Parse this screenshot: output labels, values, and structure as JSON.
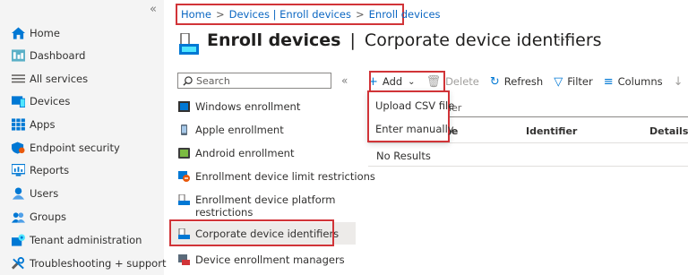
{
  "leftnav": {
    "collapse": "«",
    "items": [
      {
        "label": "Home",
        "icon": "home-icon"
      },
      {
        "label": "Dashboard",
        "icon": "dashboard-icon"
      },
      {
        "label": "All services",
        "icon": "list-icon"
      },
      {
        "label": "Devices",
        "icon": "devices-icon"
      },
      {
        "label": "Apps",
        "icon": "apps-icon"
      },
      {
        "label": "Endpoint security",
        "icon": "shield-icon"
      },
      {
        "label": "Reports",
        "icon": "reports-icon"
      },
      {
        "label": "Users",
        "icon": "user-icon"
      },
      {
        "label": "Groups",
        "icon": "groups-icon"
      },
      {
        "label": "Tenant administration",
        "icon": "tenant-admin-icon"
      },
      {
        "label": "Troubleshooting + support",
        "icon": "wrench-icon"
      }
    ]
  },
  "breadcrumb": {
    "items": [
      "Home",
      "Devices | Enroll devices",
      "Enroll devices"
    ],
    "separator": ">"
  },
  "header": {
    "title": "Enroll devices",
    "separator": "|",
    "subtitle": "Corporate device identifiers",
    "more": "···"
  },
  "subnav": {
    "search_placeholder": "Search",
    "collapse": "«",
    "items": [
      {
        "label": "Windows enrollment"
      },
      {
        "label": "Apple enrollment"
      },
      {
        "label": "Android enrollment"
      },
      {
        "label": "Enrollment device limit restrictions"
      },
      {
        "label_line1": "Enrollment device platform",
        "label_line2": "restrictions"
      },
      {
        "label": "Corporate device identifiers",
        "selected": true
      },
      {
        "label": "Device enrollment managers"
      }
    ]
  },
  "toolbar": {
    "add": "Add",
    "delete": "Delete",
    "refresh": "Refresh",
    "filter": "Filter",
    "columns": "Columns"
  },
  "add_menu": {
    "items": [
      "Upload CSV file",
      "Enter manually"
    ]
  },
  "table": {
    "filter_text": "ifier",
    "columns": [
      "pe",
      "Identifier",
      "Details"
    ],
    "empty": "No Results"
  },
  "colors": {
    "accent": "#0078d4",
    "highlight": "#d13438",
    "link": "#0a66c2"
  }
}
